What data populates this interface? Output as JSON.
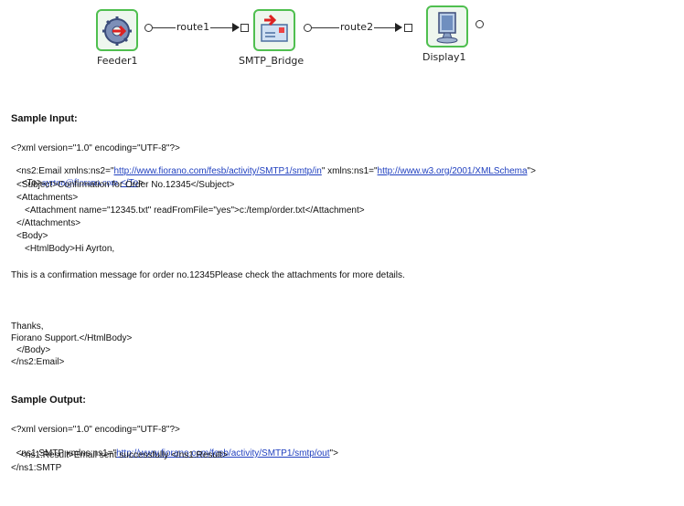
{
  "flow": {
    "nodes": [
      {
        "label": "Feeder1",
        "icon": "feeder-gear-icon"
      },
      {
        "label": "SMTP_Bridge",
        "icon": "mail-arrow-icon"
      },
      {
        "label": "Display1",
        "icon": "monitor-icon"
      }
    ],
    "routes": [
      "route1",
      "route2"
    ],
    "colors": {
      "node_border": "#4fbf4f",
      "link": "#1f3fbf"
    }
  },
  "input": {
    "heading": "Sample Input:",
    "xml_decl": "<?xml version=\"1.0\" encoding=\"UTF-8\"?>",
    "email_open_a": "<ns2:Email xmlns:ns2=\"",
    "email_ns2_url": "http://www.fiorano.com/fesb/activity/SMTP1/smtp/in",
    "email_open_b": "\" xmlns:ns1=\"",
    "email_ns1_url": "http://www.w3.org/2001/XMLSchema",
    "email_open_c": "\">",
    "to_open": "<To>",
    "to_value": "ayrton@fiorano.com",
    "to_close": "</To",
    "to_end": ">",
    "subject": "<Subject>Confirmation for Order No.12345</Subject>",
    "attachments_open": "<Attachments>",
    "attachment": "<Attachment name=\"12345.txt\" readFromFile=\"yes\">c:/temp/order.txt</Attachment>",
    "attachments_close": "</Attachments>",
    "body_open": "<Body>",
    "htmlbody_open": "<HtmlBody>Hi Ayrton,",
    "message": "This is a confirmation message for order no.12345Please check the attachments for more details.",
    "thanks": "Thanks,",
    "signature": "Fiorano Support.</HtmlBody>",
    "body_close": "</Body>",
    "email_close": "</ns2:Email>"
  },
  "output": {
    "heading": "Sample Output:",
    "xml_decl": "<?xml version=\"1.0\" encoding=\"UTF-8\"?>",
    "smtp_open_a": "<ns1:SMTP xmlns:ns1=\"",
    "smtp_url": "http://www.fiorano.com/fesb/activity/SMTP1/smtp/out",
    "smtp_open_b": "\">",
    "result": "<ns1:Result>Email sent successfully </ns1:Result>",
    "smtp_close": "</ns1:SMTP"
  }
}
